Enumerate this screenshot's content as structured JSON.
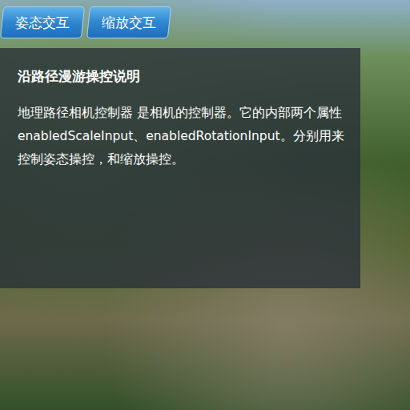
{
  "buttons": [
    "姿态交互",
    "缩放交互"
  ],
  "panel": {
    "title": "沿路径漫游操控说明",
    "body": "地理路径相机控制器 是相机的控制器。它的内部两个属性enabledScaleInput、enabledRotationInput。分别用来控制姿态操控，和缩放操控。"
  }
}
